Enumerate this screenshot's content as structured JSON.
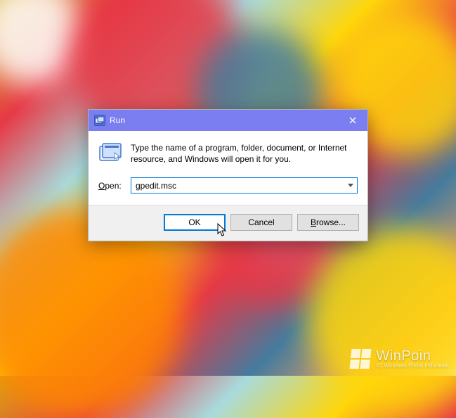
{
  "dialog": {
    "title": "Run",
    "instruction": "Type the name of a program, folder, document, or Internet resource, and Windows will open it for you.",
    "open_label_u": "O",
    "open_label_rest": "pen:",
    "input_value": "gpedit.msc",
    "ok_label": "OK",
    "cancel_label": "Cancel",
    "browse_label_u": "B",
    "browse_label_rest": "rowse..."
  },
  "watermark": {
    "main": "WinPoin",
    "sub": "#1 Windows Portal Indonesia"
  }
}
